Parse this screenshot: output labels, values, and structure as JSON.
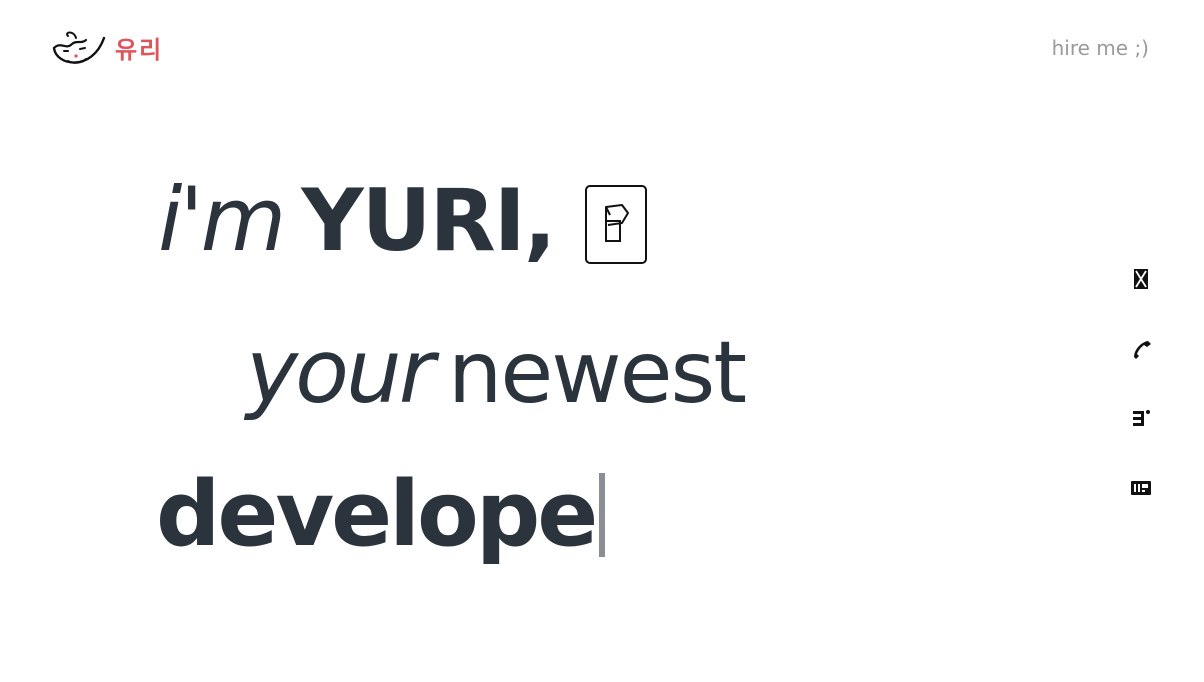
{
  "header": {
    "brand": "유리",
    "hire_link": "hire me ;)"
  },
  "hero": {
    "greeting": "i'm",
    "name": "YURI,",
    "adjective": "your",
    "descriptor": "newest",
    "typed_text": "develope"
  },
  "social": [
    {
      "icon": "x-social-icon"
    },
    {
      "icon": "phone-icon"
    },
    {
      "icon": "resume-icon"
    },
    {
      "icon": "portfolio-icon"
    }
  ],
  "colors": {
    "brand": "#e0545b",
    "text": "#2b333d",
    "muted": "#9a9a9a"
  }
}
